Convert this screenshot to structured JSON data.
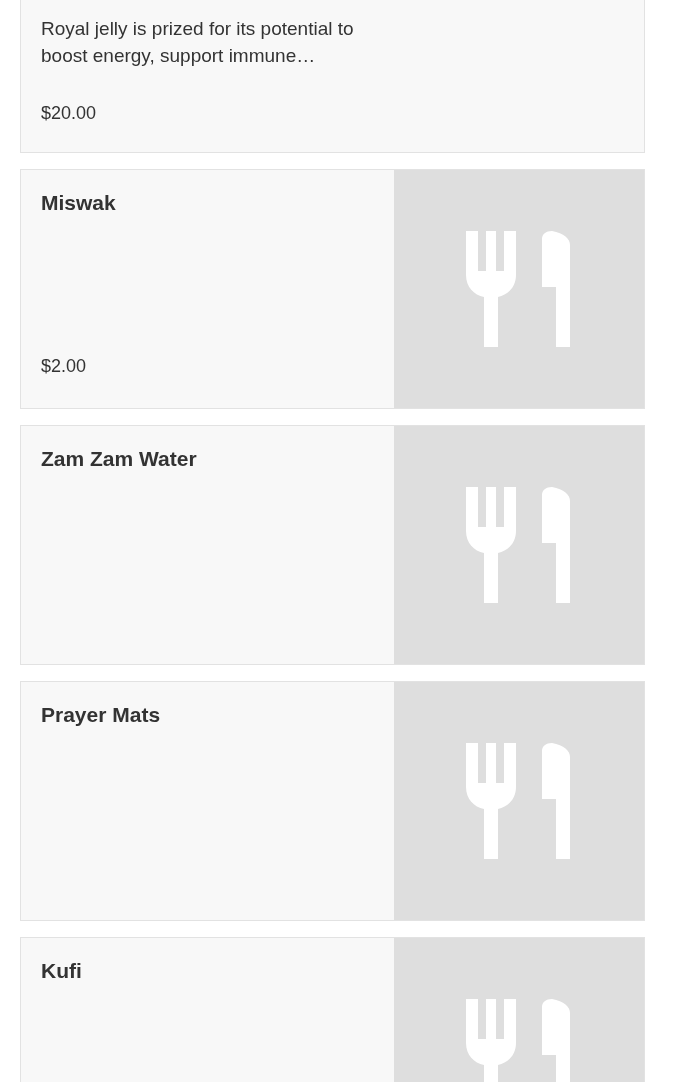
{
  "products": [
    {
      "description": "Royal jelly is prized for its potential to boost energy, support immune…",
      "price": "$20.00"
    },
    {
      "name": "Miswak",
      "price": "$2.00",
      "image": {
        "kind": "placeholder"
      }
    },
    {
      "name": "Zam Zam Water",
      "image": {
        "kind": "placeholder"
      }
    },
    {
      "name": "Prayer Mats",
      "image": {
        "kind": "placeholder"
      }
    },
    {
      "name": "Kufi",
      "image": {
        "kind": "placeholder"
      }
    }
  ]
}
